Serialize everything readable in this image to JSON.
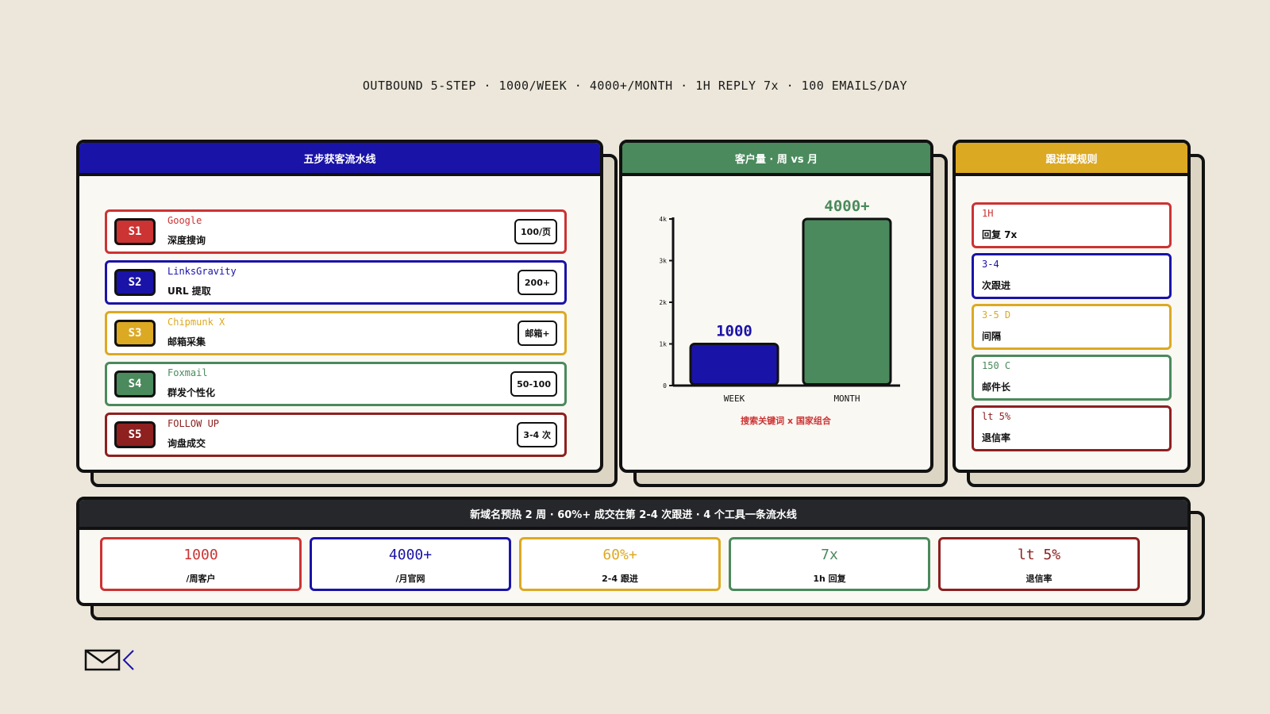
{
  "header": {
    "title": "OUTBOUND 5-STEP · 1000/WEEK · 4000+/MONTH · 1H REPLY 7x · 100 EMAILS/DAY"
  },
  "colors": {
    "blue": "#1a13a8",
    "green": "#4a8a5c",
    "yellow": "#dca923",
    "red": "#cc3333",
    "darkred": "#8e2020",
    "dark": "#26272b"
  },
  "pipeline": {
    "title": "五步获客流水线",
    "steps": [
      {
        "badge": "S1",
        "tool": "Google",
        "desc": "深度搜询",
        "metric": "100/页",
        "color": "#cc3333"
      },
      {
        "badge": "S2",
        "tool": "LinksGravity",
        "desc": "URL 提取",
        "metric": "200+",
        "color": "#1a13a8"
      },
      {
        "badge": "S3",
        "tool": "Chipmunk X",
        "desc": "邮箱采集",
        "metric": "邮箱+",
        "color": "#dca923"
      },
      {
        "badge": "S4",
        "tool": "Foxmail",
        "desc": "群发个性化",
        "metric": "50-100",
        "color": "#4a8a5c"
      },
      {
        "badge": "S5",
        "tool": "FOLLOW UP",
        "desc": "询盘成交",
        "metric": "3-4 次",
        "color": "#8e2020"
      }
    ]
  },
  "volume": {
    "title": "客户量 · 周 vs 月",
    "caption": "搜索关键词 x 国家组合"
  },
  "chart_data": {
    "type": "bar",
    "categories": [
      "WEEK",
      "MONTH"
    ],
    "values": [
      1000,
      4000
    ],
    "value_labels": [
      "1000",
      "4000+"
    ],
    "colors": [
      "#1a13a8",
      "#4a8a5c"
    ],
    "yticks": [
      "0",
      "1k",
      "2k",
      "3k",
      "4k"
    ],
    "ylim": [
      0,
      4000
    ],
    "title": "",
    "xlabel": "",
    "ylabel": "",
    "grid": false
  },
  "rules": {
    "title": "跟进硬规则",
    "items": [
      {
        "key": "1H",
        "label": "回复 7x",
        "color": "#cc3333"
      },
      {
        "key": "3-4",
        "label": "次跟进",
        "color": "#1a13a8"
      },
      {
        "key": "3-5 D",
        "label": "间隔",
        "color": "#dca923"
      },
      {
        "key": "150 C",
        "label": "邮件长",
        "color": "#4a8a5c"
      },
      {
        "key": "lt 5%",
        "label": "退信率",
        "color": "#8e2020"
      }
    ]
  },
  "summary": {
    "title": "新域名预热 2 周 · 60%+ 成交在第 2-4 次跟进 · 4 个工具一条流水线",
    "stats": [
      {
        "value": "1000",
        "label": "/周客户",
        "color": "#cc3333"
      },
      {
        "value": "4000+",
        "label": "/月官网",
        "color": "#1a13a8"
      },
      {
        "value": "60%+",
        "label": "2-4 跟进",
        "color": "#dca923"
      },
      {
        "value": "7x",
        "label": "1h 回复",
        "color": "#4a8a5c"
      },
      {
        "value": "lt 5%",
        "label": "退信率",
        "color": "#8e2020"
      }
    ]
  }
}
